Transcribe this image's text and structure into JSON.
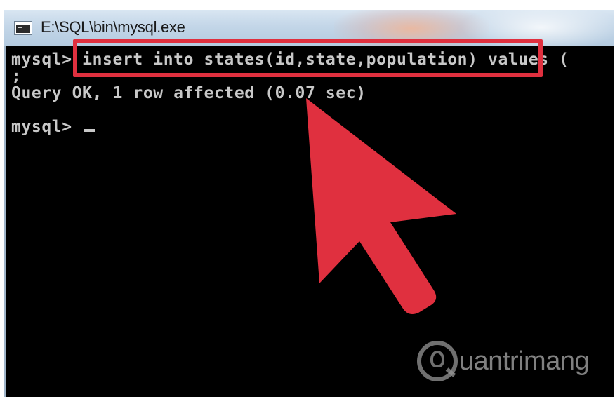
{
  "window": {
    "title": "E:\\SQL\\bin\\mysql.exe",
    "icon": "console-window-icon"
  },
  "console": {
    "line1_prompt": "mysql>",
    "line1_command": " insert into states(id,state,population) ",
    "line1_overflow": "values (",
    "line2": ";",
    "line3": "Query OK, 1 row affected (0.07 sec)",
    "line4_prompt": "mysql> "
  },
  "annotations": {
    "highlight_color": "#e0303f",
    "arrow_color": "#e0303f",
    "arrow_icon": "pointer-arrow-icon"
  },
  "watermark": {
    "logo": "lightbulb-logo-icon",
    "text": "uantrimang"
  }
}
